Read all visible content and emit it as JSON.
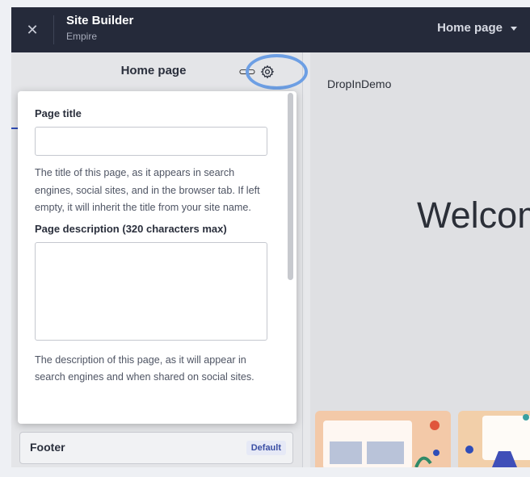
{
  "topbar": {
    "app_title": "Site Builder",
    "app_subtitle": "Empire",
    "page_select_value": "Home page"
  },
  "left_panel": {
    "title": "Home page",
    "footer": {
      "label": "Footer",
      "badge": "Default"
    }
  },
  "preview": {
    "brand": "DropInDemo",
    "hero_text": "Welcome"
  },
  "settings_popover": {
    "page_title_label": "Page title",
    "page_title_value": "",
    "page_title_help": "The title of this page, as it appears in search engines, social sites, and in the browser tab. If left empty, it will inherit the title from your site name.",
    "page_description_label": "Page description (320 characters max)",
    "page_description_value": "",
    "page_description_help": "The description of this page, as it will appear in search engines and when shared on social sites."
  },
  "colors": {
    "topbar_bg": "#252a3a",
    "highlight_ring": "#6d9fe4",
    "accent": "#2f4db8"
  },
  "icons": [
    "close-icon",
    "chevron-down-icon",
    "link-icon",
    "gear-icon"
  ]
}
